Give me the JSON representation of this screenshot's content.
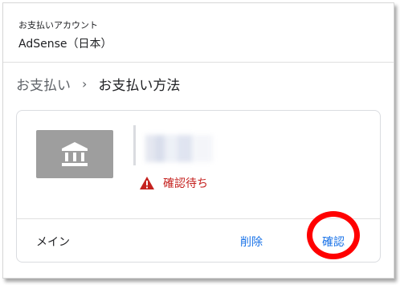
{
  "header": {
    "account_label": "お支払いアカウント",
    "account_name": "AdSense（日本）"
  },
  "breadcrumb": {
    "parent": "お支払い",
    "separator": "›",
    "current": "お支払い方法"
  },
  "payment_card": {
    "icon": "bank-icon",
    "status_icon": "warning-icon",
    "status_text": "確認待ち",
    "footer_label": "メイン",
    "delete_label": "削除",
    "verify_label": "確認"
  },
  "colors": {
    "link": "#1a73e8",
    "warning": "#c5221f",
    "highlight": "#ff0000",
    "tile": "#9e9e9e"
  }
}
